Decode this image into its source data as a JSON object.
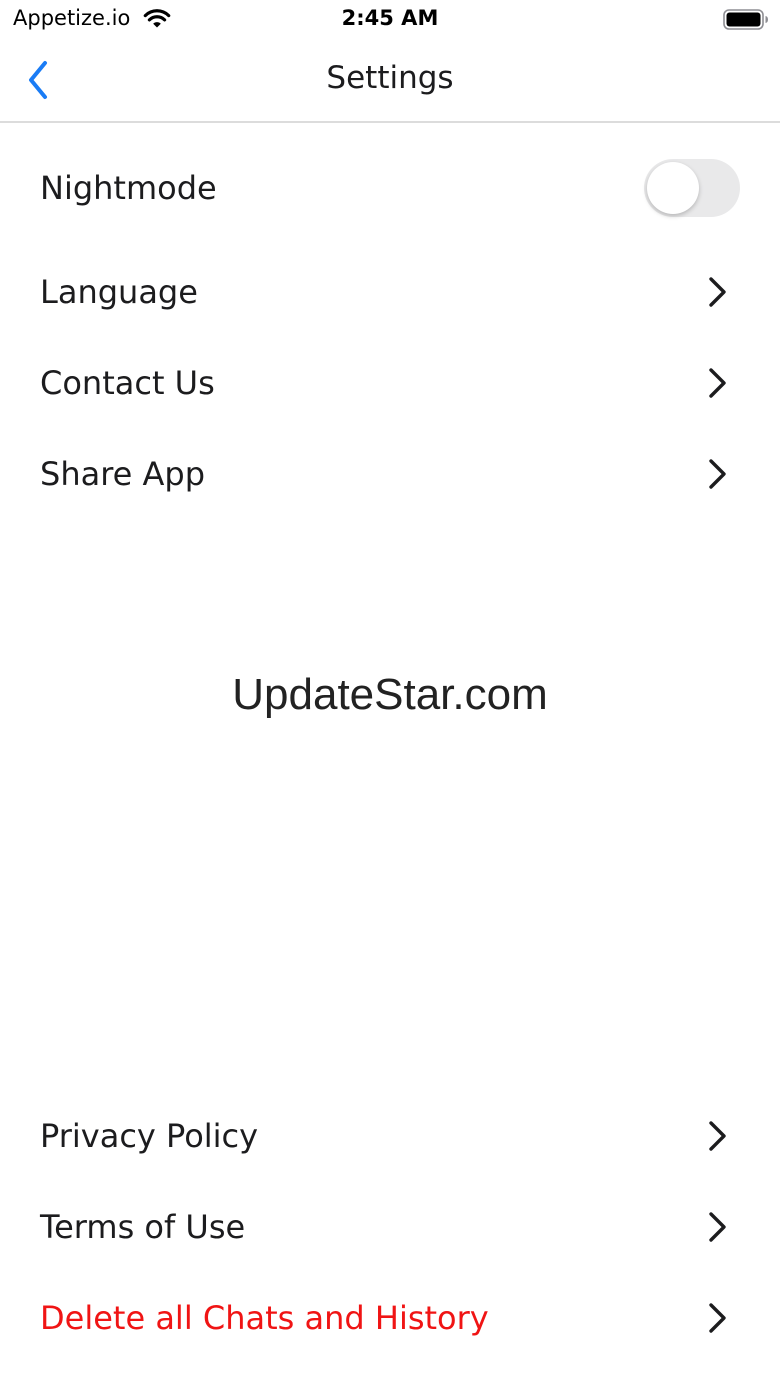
{
  "status_bar": {
    "carrier": "Appetize.io",
    "time": "2:45 AM",
    "wifi_icon": "wifi-icon",
    "battery_icon": "battery-full-icon"
  },
  "nav": {
    "title": "Settings",
    "back_icon": "chevron-left-icon"
  },
  "settings": {
    "nightmode": {
      "label": "Nightmode",
      "enabled": false
    },
    "language": {
      "label": "Language"
    },
    "contact_us": {
      "label": "Contact Us"
    },
    "share_app": {
      "label": "Share App"
    },
    "privacy_policy": {
      "label": "Privacy Policy"
    },
    "terms_of_use": {
      "label": "Terms of Use"
    },
    "delete_history": {
      "label": "Delete all Chats and History"
    }
  },
  "watermark": "UpdateStar.com",
  "colors": {
    "accent": "#1a7cf5",
    "danger": "#f01414",
    "toggle_off": "#e9e9ea",
    "separator": "#dcdcdc"
  }
}
